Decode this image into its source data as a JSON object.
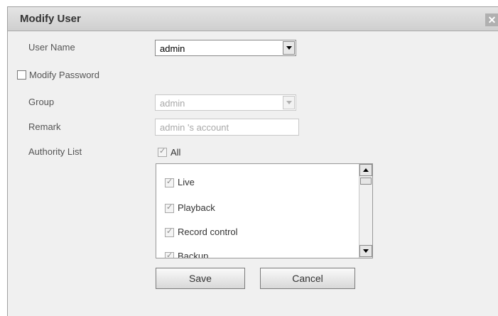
{
  "dialog": {
    "title": "Modify User",
    "close_symbol": "✕"
  },
  "form": {
    "user_name_label": "User Name",
    "user_name_value": "admin",
    "modify_password_label": "Modify Password",
    "group_label": "Group",
    "group_value": "admin",
    "remark_label": "Remark",
    "remark_value": "admin 's account",
    "authority_label": "Authority List",
    "all_label": "All"
  },
  "authority_items": [
    {
      "label": "Live"
    },
    {
      "label": "Playback"
    },
    {
      "label": "Record control"
    },
    {
      "label": "Backup"
    }
  ],
  "buttons": {
    "save": "Save",
    "cancel": "Cancel"
  }
}
